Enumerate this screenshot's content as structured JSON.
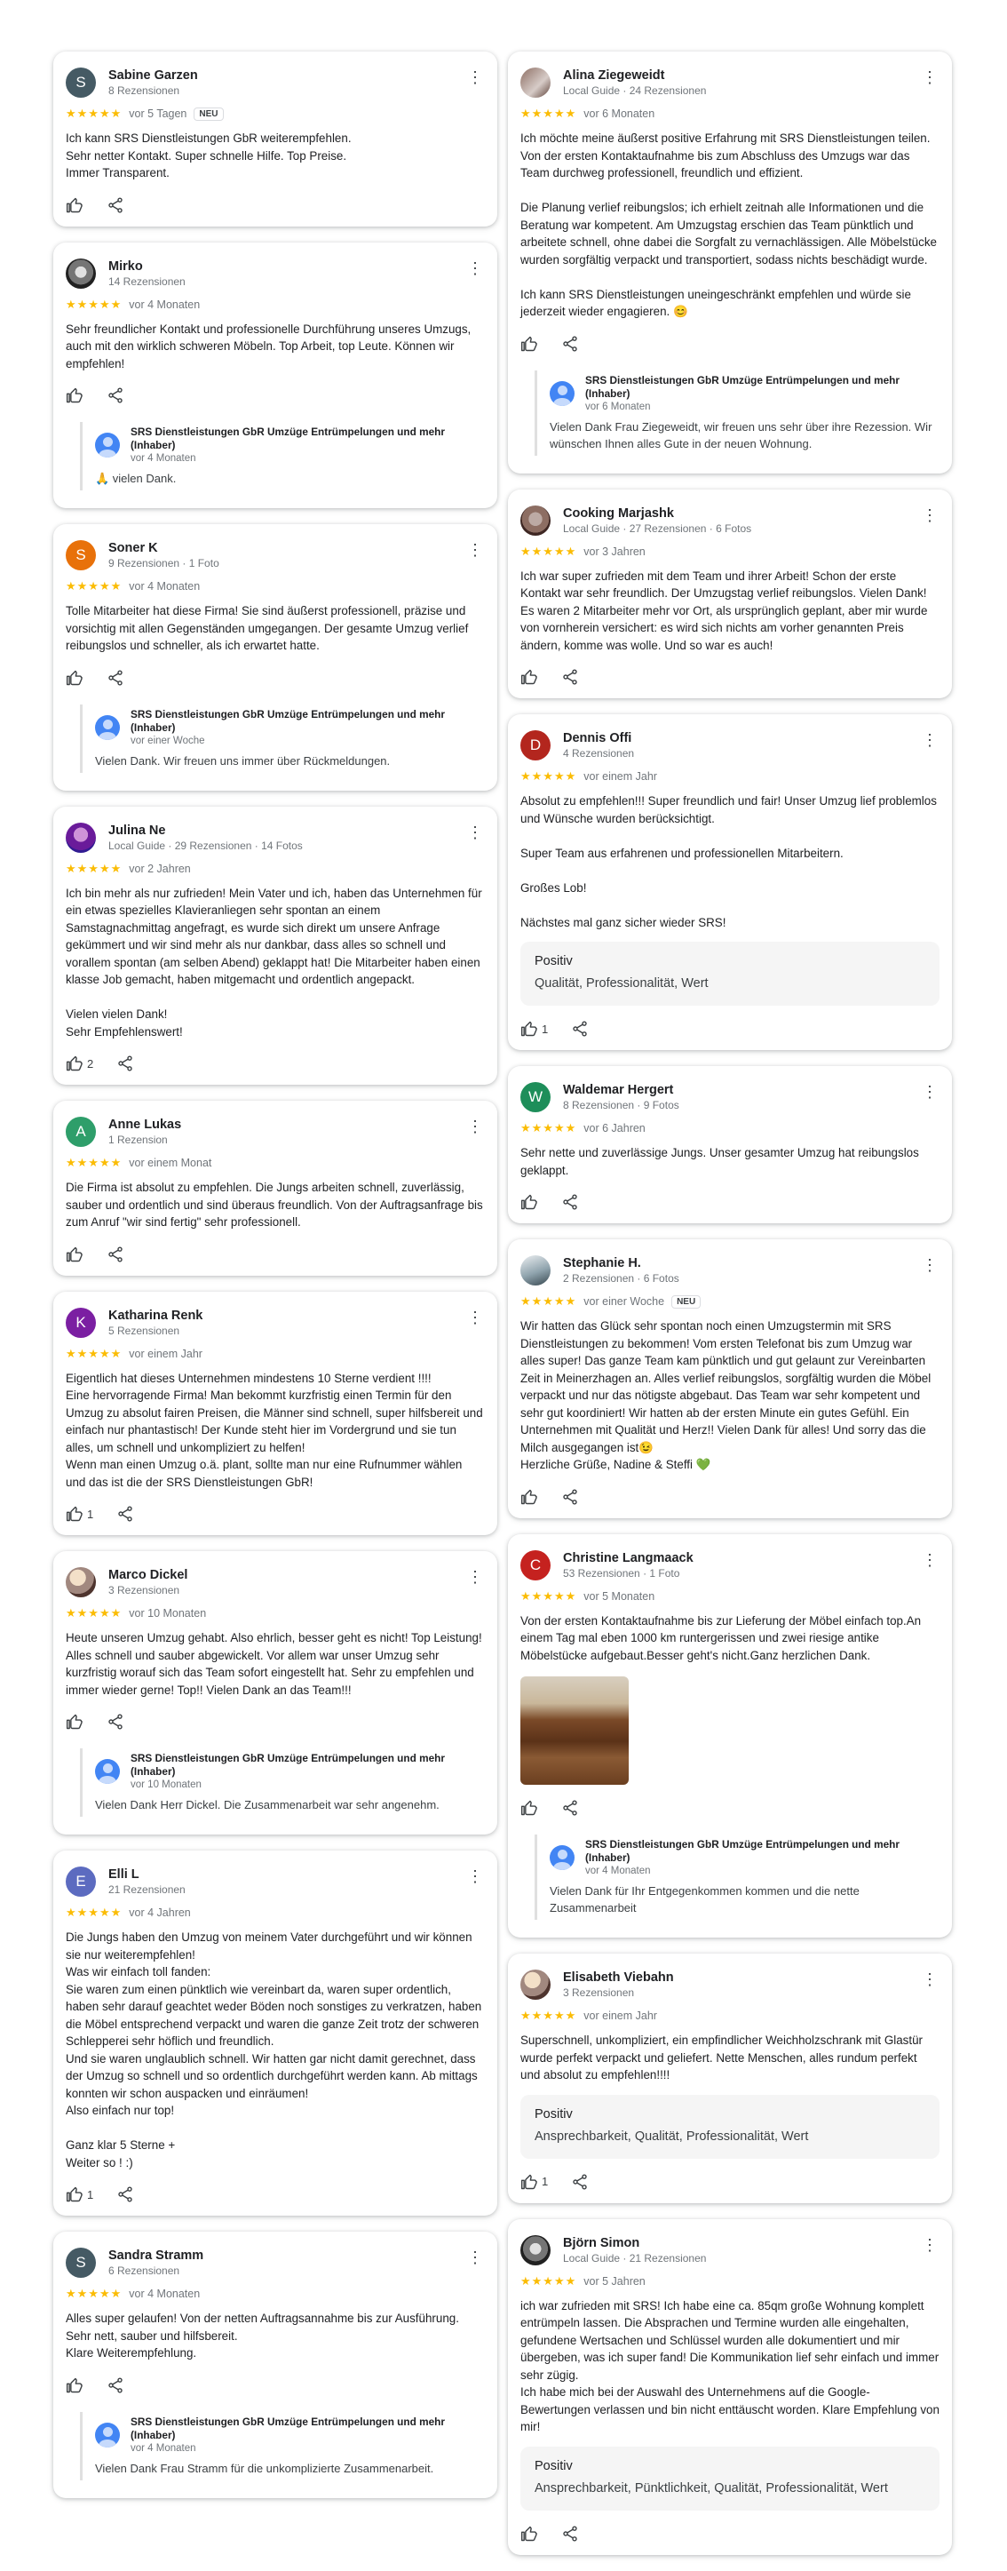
{
  "labels": {
    "positive_title": "Positiv"
  },
  "left": [
    {
      "name": "Sabine Garzen",
      "sub": "8 Rezensionen",
      "initial": "S",
      "avatar_color": "#455a64",
      "stars": "★★★★★",
      "time": "vor 5 Tagen",
      "badge": "NEU",
      "text": "Ich kann SRS Dienstleistungen GbR weiterempfehlen.\nSehr netter Kontakt. Super schnelle Hilfe. Top Preise.\nImmer Transparent.",
      "likes": ""
    },
    {
      "name": "Mirko",
      "sub": "14 Rezensionen",
      "initial": "",
      "photo": "photo5",
      "stars": "★★★★★",
      "time": "vor 4 Monaten",
      "text": "Sehr freundlicher Kontakt und professionelle Durchführung unseres Umzugs, auch mit den wirklich schweren Möbeln. Top Arbeit, top Leute. Können wir empfehlen!",
      "likes": "",
      "owner": {
        "name": "SRS Dienstleistungen GbR Umzüge Entrümpelungen und mehr (Inhaber)",
        "time": "vor 4 Monaten",
        "text": "🙏 vielen Dank."
      }
    },
    {
      "name": "Soner K",
      "sub": "9 Rezensionen · 1 Foto",
      "initial": "S",
      "avatar_color": "#e8710a",
      "stars": "★★★★★",
      "time": "vor 4 Monaten",
      "text": "Tolle Mitarbeiter hat diese Firma! Sie sind äußerst professionell, präzise und vorsichtig mit allen Gegenständen umgegangen. Der gesamte Umzug verlief reibungslos und schneller, als ich erwartet hatte.",
      "likes": "",
      "owner": {
        "name": "SRS Dienstleistungen GbR Umzüge Entrümpelungen und mehr (Inhaber)",
        "time": "vor einer Woche",
        "text": "Vielen Dank. Wir freuen uns immer über Rückmeldungen."
      }
    },
    {
      "name": "Julina Ne",
      "sub": "Local Guide · 29 Rezensionen · 14 Fotos",
      "initial": "",
      "photo": "photo3",
      "stars": "★★★★★",
      "time": "vor 2 Jahren",
      "text": "Ich bin mehr als nur zufrieden! Mein Vater und ich, haben das Unternehmen für ein etwas spezielles Klavieranliegen sehr spontan an einem Samstagnachmittag angefragt, es wurde sich direkt um unsere Anfrage gekümmert und wir sind mehr als nur dankbar, dass alles so schnell und vorallem spontan (am selben Abend) geklappt hat! Die Mitarbeiter haben einen klasse Job gemacht, haben mitgemacht und ordentlich angepackt.\n\nVielen vielen Dank!\nSehr Empfehlenswert!",
      "likes": "2"
    },
    {
      "name": "Anne Lukas",
      "sub": "1 Rezension",
      "initial": "A",
      "avatar_color": "#2e9e6a",
      "stars": "★★★★★",
      "time": "vor einem Monat",
      "text": "Die Firma ist absolut zu empfehlen. Die Jungs arbeiten schnell, zuverlässig, sauber und ordentlich und sind überaus freundlich. Von der Auftragsanfrage bis zum Anruf \"wir sind fertig\" sehr professionell.",
      "likes": ""
    },
    {
      "name": "Katharina Renk",
      "sub": "5 Rezensionen",
      "initial": "K",
      "avatar_color": "#7b1fa2",
      "stars": "★★★★★",
      "time": "vor einem Jahr",
      "text": "Eigentlich hat dieses Unternehmen mindestens 10 Sterne verdient !!!!\nEine hervorragende Firma! Man bekommt kurzfristig einen Termin für den Umzug zu absolut fairen Preisen, die Männer sind schnell, super hilfsbereit und einfach nur phantastisch! Der Kunde steht hier im Vordergrund und sie tun alles, um schnell und unkompliziert zu helfen!\nWenn man einen Umzug o.ä. plant, sollte man nur eine Rufnummer wählen und das ist die der SRS Dienstleistungen GbR!",
      "likes": "1"
    },
    {
      "name": "Marco Dickel",
      "sub": "3 Rezensionen",
      "initial": "",
      "photo": "photo2",
      "stars": "★★★★★",
      "time": "vor 10 Monaten",
      "text": "Heute unseren Umzug gehabt. Also ehrlich, besser geht es nicht! Top Leistung! Alles schnell und sauber abgewickelt. Vor allem war unser Umzug sehr kurzfristig worauf sich das Team sofort eingestellt hat. Sehr zu empfehlen und immer wieder gerne! Top!! Vielen Dank an das Team!!!",
      "likes": "",
      "owner": {
        "name": "SRS Dienstleistungen GbR Umzüge Entrümpelungen und mehr (Inhaber)",
        "time": "vor 10 Monaten",
        "text": "Vielen Dank Herr Dickel. Die Zusammenarbeit war sehr angenehm."
      }
    },
    {
      "name": "Elli L",
      "sub": "21 Rezensionen",
      "initial": "E",
      "avatar_color": "#5c6bc0",
      "stars": "★★★★★",
      "time": "vor 4 Jahren",
      "text": "Die Jungs haben den Umzug von meinem Vater durchgeführt und wir können sie nur weiterempfehlen!\nWas wir einfach toll fanden:\nSie waren zum einen pünktlich wie vereinbart da, waren super ordentlich, haben sehr darauf geachtet weder Böden noch sonstiges zu verkratzen, haben die Möbel entsprechend verpackt und waren die ganze Zeit trotz der schweren Schlepperei sehr höflich und freundlich.\nUnd sie waren unglaublich schnell. Wir hatten gar nicht damit gerechnet, dass der Umzug so schnell und so ordentlich durchgeführt werden kann. Ab mittags konnten wir schon auspacken und einräumen!\nAlso einfach nur top!\n\nGanz klar 5 Sterne +\nWeiter so ! :)",
      "likes": "1"
    },
    {
      "name": "Sandra Stramm",
      "sub": "6 Rezensionen",
      "initial": "S",
      "avatar_color": "#455a64",
      "stars": "★★★★★",
      "time": "vor 4 Monaten",
      "text": "Alles super gelaufen! Von der netten Auftragsannahme bis zur Ausführung. Sehr nett, sauber und hilfsbereit.\nKlare Weiterempfehlung.",
      "likes": "",
      "owner": {
        "name": "SRS Dienstleistungen GbR Umzüge Entrümpelungen und mehr (Inhaber)",
        "time": "vor 4 Monaten",
        "text": "Vielen Dank Frau Stramm für die unkomplizierte Zusammenarbeit."
      }
    }
  ],
  "right": [
    {
      "name": "Alina Ziegeweidt",
      "sub": "Local Guide · 24 Rezensionen",
      "initial": "",
      "photo": "photo",
      "stars": "★★★★★",
      "time": "vor 6 Monaten",
      "text": "Ich möchte meine äußerst positive Erfahrung mit SRS Dienstleistungen teilen. Von der ersten Kontaktaufnahme bis zum Abschluss des Umzugs war das Team durchweg professionell, freundlich und effizient.\n\nDie Planung verlief reibungslos; ich erhielt zeitnah alle Informationen und die Beratung war kompetent. Am Umzugstag erschien das Team pünktlich und arbeitete schnell, ohne dabei die Sorgfalt zu vernachlässigen. Alle Möbelstücke wurden sorgfältig verpackt und transportiert, sodass nichts beschädigt wurde.\n\nIch kann SRS Dienstleistungen uneingeschränkt empfehlen und würde sie jederzeit wieder engagieren. 😊",
      "likes": "",
      "owner": {
        "name": "SRS Dienstleistungen GbR Umzüge Entrümpelungen und mehr (Inhaber)",
        "time": "vor 6 Monaten",
        "text": "Vielen Dank Frau Ziegeweidt, wir freuen uns sehr über ihre Rezession. Wir wünschen Ihnen alles Gute in der neuen Wohnung."
      }
    },
    {
      "name": "Cooking Marjashk",
      "sub": "Local Guide · 27 Rezensionen · 6 Fotos",
      "initial": "",
      "photo": "photo6",
      "stars": "★★★★★",
      "time": "vor 3 Jahren",
      "text": "Ich war super zufrieden mit dem Team und ihrer Arbeit! Schon der erste Kontakt war sehr freundlich. Der Umzugstag verlief reibungslos. Vielen Dank! Es waren 2 Mitarbeiter mehr vor Ort, als ursprünglich geplant, aber mir wurde von vornherein versichert: es wird sich nichts am vorher genannten Preis ändern, komme was wolle. Und so war es auch!",
      "likes": ""
    },
    {
      "name": "Dennis Offi",
      "sub": "4 Rezensionen",
      "initial": "D",
      "avatar_color": "#b3261e",
      "stars": "★★★★★",
      "time": "vor einem Jahr",
      "text": "Absolut zu empfehlen!!! Super freundlich und fair! Unser Umzug lief problemlos und Wünsche wurden berücksichtigt.\n\nSuper Team aus erfahrenen und professionellen Mitarbeitern.\n\nGroßes Lob!\n\nNächstes mal ganz sicher wieder SRS!",
      "likes": "1",
      "positive": "Qualität, Professionalität, Wert"
    },
    {
      "name": "Waldemar Hergert",
      "sub": "8 Rezensionen · 9 Fotos",
      "initial": "W",
      "avatar_color": "#1e8e5a",
      "stars": "★★★★★",
      "time": "vor 6 Jahren",
      "text": "Sehr nette und zuverlässige Jungs. Unser gesamter Umzug hat reibungslos geklappt.",
      "likes": ""
    },
    {
      "name": "Stephanie H.",
      "sub": "2 Rezensionen · 6 Fotos",
      "initial": "",
      "photo": "photo4",
      "stars": "★★★★★",
      "time": "vor einer Woche",
      "badge": "NEU",
      "text": "Wir hatten das Glück sehr spontan noch einen Umzugstermin mit SRS Dienstleistungen zu bekommen! Vom ersten Telefonat bis zum Umzug war alles super! Das ganze Team kam pünktlich und gut gelaunt zur Vereinbarten Zeit in Meinerzhagen an. Alles verlief reibungslos, sorgfältig wurden die Möbel verpackt und nur das nötigste abgebaut. Das Team war sehr kompetent und sehr gut koordiniert! Wir hatten ab der ersten Minute ein gutes Gefühl. Ein Unternehmen mit Qualität und Herz!! Vielen Dank für alles! Und sorry das die Milch ausgegangen ist😉\nHerzliche Grüße, Nadine & Steffi 💚",
      "likes": ""
    },
    {
      "name": "Christine Langmaack",
      "sub": "53 Rezensionen · 1 Foto",
      "initial": "C",
      "avatar_color": "#c5221f",
      "stars": "★★★★★",
      "time": "vor 5 Monaten",
      "text": "Von der ersten Kontaktaufnahme bis zur Lieferung der Möbel einfach top.An einem Tag mal eben 1000 km runtergerissen und zwei riesige antike Möbelstücke aufgebaut.Besser geht's nicht.Ganz herzlichen Dank.",
      "likes": "",
      "has_photo": true,
      "owner": {
        "name": "SRS Dienstleistungen GbR Umzüge Entrümpelungen und mehr (Inhaber)",
        "time": "vor 4 Monaten",
        "text": "Vielen Dank für Ihr Entgegenkommen kommen und die nette Zusammenarbeit"
      }
    },
    {
      "name": "Elisabeth Viebahn",
      "sub": "3 Rezensionen",
      "initial": "",
      "photo": "photo2",
      "stars": "★★★★★",
      "time": "vor einem Jahr",
      "text": "Superschnell, unkompliziert, ein empfindlicher Weichholzschrank mit Glastür wurde perfekt verpackt und geliefert. Nette Menschen, alles rundum perfekt und absolut zu empfehlen!!!!",
      "likes": "1",
      "positive": "Ansprechbarkeit, Qualität, Professionalität, Wert"
    },
    {
      "name": "Björn Simon",
      "sub": "Local Guide · 21 Rezensionen",
      "initial": "",
      "photo": "photo5",
      "stars": "★★★★★",
      "time": "vor 5 Jahren",
      "text": "ich war zufrieden mit SRS! Ich habe eine ca. 85qm große Wohnung komplett entrümpeln lassen. Die Absprachen und Termine wurden alle eingehalten, gefundene Wertsachen und Schlüssel wurden alle dokumentiert und mir übergeben, was ich super fand! Die Kommunikation lief sehr einfach und immer sehr zügig.\nIch habe mich bei der Auswahl des Unternehmens auf die Google-Bewertungen verlassen und bin nicht enttäuscht worden. Klare Empfehlung von mir!",
      "likes": "",
      "positive": "Ansprechbarkeit, Pünktlichkeit, Qualität, Professionalität, Wert"
    }
  ]
}
